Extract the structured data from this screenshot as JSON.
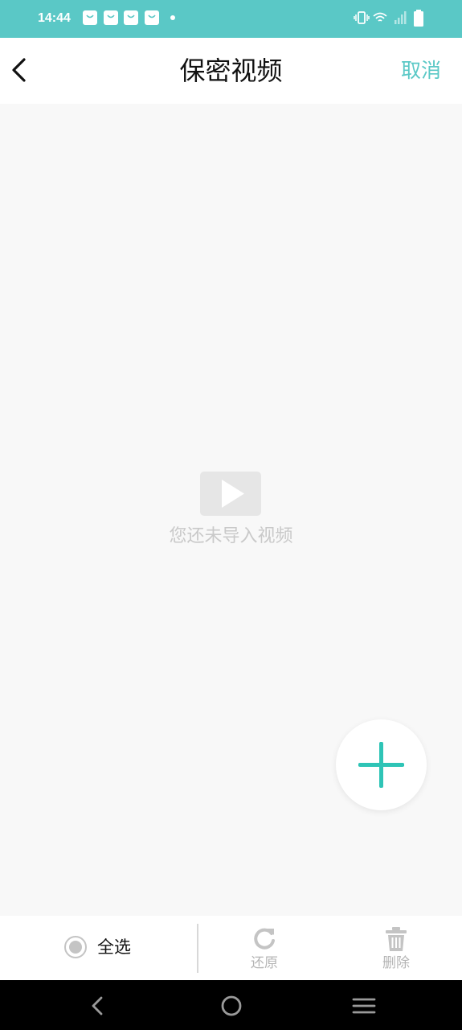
{
  "status_bar": {
    "time": "14:44",
    "background": "#5ac8c6",
    "notification_icons": [
      "shopping-bag-icon",
      "shopping-bag-icon",
      "shopping-bag-icon",
      "shopping-bag-icon"
    ],
    "right_icons": [
      "vibrate-icon",
      "wifi-icon",
      "signal-icon",
      "battery-icon"
    ]
  },
  "header": {
    "back_icon": "chevron-left-icon",
    "title": "保密视频",
    "cancel_label": "取消",
    "accent_color": "#5ac8c6"
  },
  "empty_state": {
    "icon": "video-play-icon",
    "message": "您还未导入视频"
  },
  "fab": {
    "icon": "plus-icon"
  },
  "action_bar": {
    "select_all_label": "全选",
    "restore_label": "还原",
    "restore_icon": "refresh-icon",
    "delete_label": "删除",
    "delete_icon": "trash-icon"
  },
  "nav_bar": {
    "buttons": [
      "back-icon",
      "home-icon",
      "menu-icon"
    ]
  }
}
